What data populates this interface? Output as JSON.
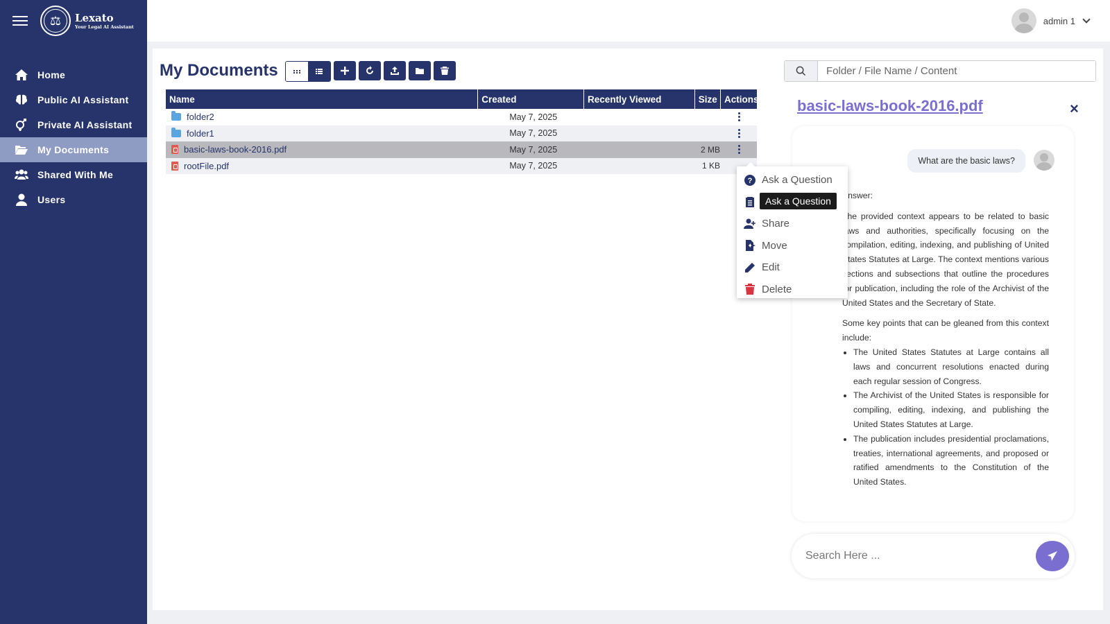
{
  "app": {
    "name": "Lexato",
    "tagline": "Your Legal AI Assistant"
  },
  "user": {
    "name": "admin 1"
  },
  "sidebar": {
    "items": [
      {
        "label": "Home",
        "icon": "home-icon"
      },
      {
        "label": "Public AI Assistant",
        "icon": "brain-icon"
      },
      {
        "label": "Private AI Assistant",
        "icon": "gender-icon"
      },
      {
        "label": "My Documents",
        "icon": "folder-open-icon",
        "active": true
      },
      {
        "label": "Shared With Me",
        "icon": "users-icon"
      },
      {
        "label": "Users",
        "icon": "user-icon"
      }
    ]
  },
  "page": {
    "title": "My Documents"
  },
  "table": {
    "headers": {
      "name": "Name",
      "created": "Created",
      "viewed": "Recently Viewed",
      "size": "Size",
      "actions": "Actions"
    },
    "rows": [
      {
        "type": "folder",
        "name": "folder2",
        "created": "May 7, 2025",
        "viewed": "",
        "size": ""
      },
      {
        "type": "folder",
        "name": "folder1",
        "created": "May 7, 2025",
        "viewed": "",
        "size": ""
      },
      {
        "type": "pdf",
        "name": "basic-laws-book-2016.pdf",
        "created": "May 7, 2025",
        "viewed": "",
        "size": "2 MB",
        "selected": true
      },
      {
        "type": "pdf",
        "name": "rootFile.pdf",
        "created": "May 7, 2025",
        "viewed": "",
        "size": "1 KB"
      }
    ]
  },
  "menu": {
    "ask": "Ask a Question",
    "share": "Share",
    "move": "Move",
    "edit": "Edit",
    "delete": "Delete",
    "tooltip": "Ask a Question"
  },
  "search": {
    "placeholder": "Folder / File Name / Content"
  },
  "panel": {
    "doc_title": "basic-laws-book-2016.pdf",
    "close": "×",
    "question": "What are the basic laws?",
    "answer_label": "Answer:",
    "answer_p1": "The provided context appears to be related to basic laws and authorities, specifically focusing on the compilation, editing, indexing, and publishing of United States Statutes at Large. The context mentions various sections and subsections that outline the procedures for publication, including the role of the Archivist of the United States and the Secretary of State.",
    "answer_p2": "Some key points that can be gleaned from this context include:",
    "bullets": [
      "The United States Statutes at Large contains all laws and concurrent resolutions enacted during each regular session of Congress.",
      "The Archivist of the United States is responsible for compiling, editing, indexing, and publishing the United States Statutes at Large.",
      "The publication includes presidential proclamations, treaties, international agreements, and proposed or ratified amendments to the Constitution of the United States."
    ],
    "chat_placeholder": "Search Here ..."
  },
  "colors": {
    "primary": "#26346b",
    "accent": "#7a6fd0",
    "active_nav": "#8e9bc3",
    "delete": "#d9343f",
    "folder": "#5aa5e0",
    "pdf": "#e05a4f"
  }
}
